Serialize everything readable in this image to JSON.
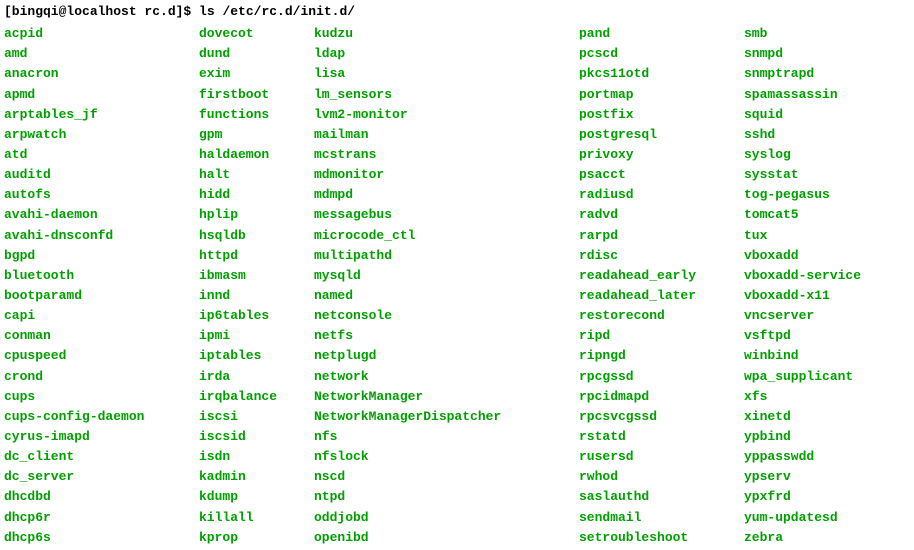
{
  "prompt": {
    "user_host": "[bingqi@localhost rc.d]$ ",
    "command": "ls /etc/rc.d/init.d/"
  },
  "listing": {
    "columns": [
      [
        "acpid",
        "amd",
        "anacron",
        "apmd",
        "arptables_jf",
        "arpwatch",
        "atd",
        "auditd",
        "autofs",
        "avahi-daemon",
        "avahi-dnsconfd",
        "bgpd",
        "bluetooth",
        "bootparamd",
        "capi",
        "conman",
        "cpuspeed",
        "crond",
        "cups",
        "cups-config-daemon",
        "cyrus-imapd",
        "dc_client",
        "dc_server",
        "dhcdbd",
        "dhcp6r",
        "dhcp6s"
      ],
      [
        "dovecot",
        "dund",
        "exim",
        "firstboot",
        "functions",
        "gpm",
        "haldaemon",
        "halt",
        "hidd",
        "hplip",
        "hsqldb",
        "httpd",
        "ibmasm",
        "innd",
        "ip6tables",
        "ipmi",
        "iptables",
        "irda",
        "irqbalance",
        "iscsi",
        "iscsid",
        "isdn",
        "kadmin",
        "kdump",
        "killall",
        "kprop"
      ],
      [
        "kudzu",
        "ldap",
        "lisa",
        "lm_sensors",
        "lvm2-monitor",
        "mailman",
        "mcstrans",
        "mdmonitor",
        "mdmpd",
        "messagebus",
        "microcode_ctl",
        "multipathd",
        "mysqld",
        "named",
        "netconsole",
        "netfs",
        "netplugd",
        "network",
        "NetworkManager",
        "NetworkManagerDispatcher",
        "nfs",
        "nfslock",
        "nscd",
        "ntpd",
        "oddjobd",
        "openibd"
      ],
      [
        "pand",
        "pcscd",
        "pkcs11otd",
        "portmap",
        "postfix",
        "postgresql",
        "privoxy",
        "psacct",
        "radiusd",
        "radvd",
        "rarpd",
        "rdisc",
        "readahead_early",
        "readahead_later",
        "restorecond",
        "ripd",
        "ripngd",
        "rpcgssd",
        "rpcidmapd",
        "rpcsvcgssd",
        "rstatd",
        "rusersd",
        "rwhod",
        "saslauthd",
        "sendmail",
        "setroubleshoot"
      ],
      [
        "smb",
        "snmpd",
        "snmptrapd",
        "spamassassin",
        "squid",
        "sshd",
        "syslog",
        "sysstat",
        "tog-pegasus",
        "tomcat5",
        "tux",
        "vboxadd",
        "vboxadd-service",
        "vboxadd-x11",
        "vncserver",
        "vsftpd",
        "winbind",
        "wpa_supplicant",
        "xfs",
        "xinetd",
        "ypbind",
        "yppasswdd",
        "ypserv",
        "ypxfrd",
        "yum-updatesd",
        "zebra"
      ]
    ]
  }
}
